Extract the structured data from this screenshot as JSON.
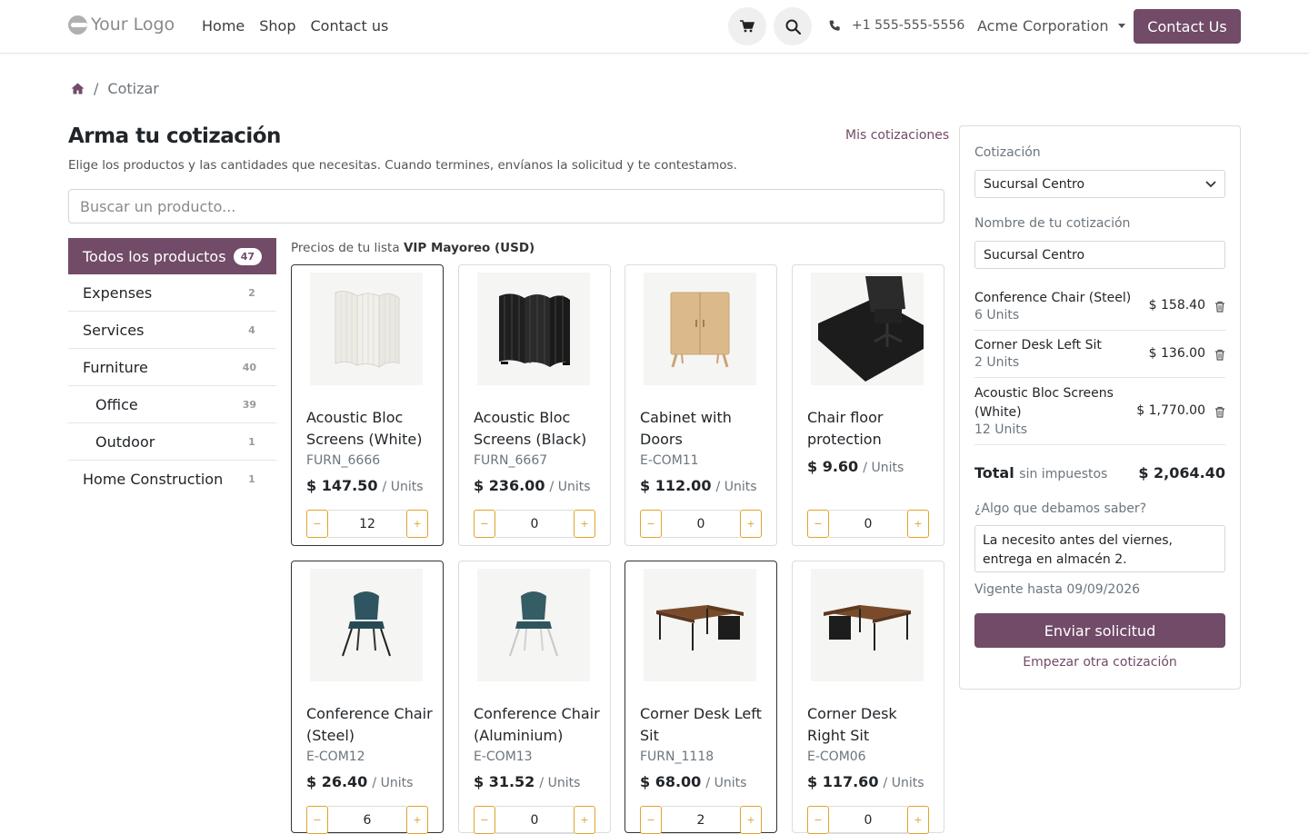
{
  "header": {
    "logo_text": "Your Logo",
    "nav": [
      "Home",
      "Shop",
      "Contact us"
    ],
    "phone": "+1 555-555-5556",
    "company": "Acme Corporation",
    "contact_button": "Contact Us"
  },
  "breadcrumb": {
    "current": "Cotizar"
  },
  "page": {
    "title": "Arma tu cotización",
    "subtitle": "Elige los productos y las cantidades que necesitas. Cuando termines, envíanos la solicitud y te contestamos.",
    "my_quotes_link": "Mis cotizaciones",
    "search_placeholder": "Buscar un producto..."
  },
  "categories": [
    {
      "label": "Todos los productos",
      "count": "47",
      "active": true,
      "sub": false
    },
    {
      "label": "Expenses",
      "count": "2",
      "active": false,
      "sub": false
    },
    {
      "label": "Services",
      "count": "4",
      "active": false,
      "sub": false
    },
    {
      "label": "Furniture",
      "count": "40",
      "active": false,
      "sub": false
    },
    {
      "label": "Office",
      "count": "39",
      "active": false,
      "sub": true
    },
    {
      "label": "Outdoor",
      "count": "1",
      "active": false,
      "sub": true
    },
    {
      "label": "Home Construction",
      "count": "1",
      "active": false,
      "sub": false
    }
  ],
  "pricelist": {
    "prefix": "Precios de tu lista",
    "name": "VIP Mayoreo (USD)"
  },
  "products": [
    {
      "name": "Acoustic Bloc Screens (White)",
      "code": "FURN_6666",
      "price": "$ 147.50",
      "unit": "/ Units",
      "qty": "12",
      "selected": true,
      "img": "screen-white"
    },
    {
      "name": "Acoustic Bloc Screens (Black)",
      "code": "FURN_6667",
      "price": "$ 236.00",
      "unit": "/ Units",
      "qty": "0",
      "selected": false,
      "img": "screen-black"
    },
    {
      "name": "Cabinet with Doors",
      "code": "E-COM11",
      "price": "$ 112.00",
      "unit": "/ Units",
      "qty": "0",
      "selected": false,
      "img": "cabinet"
    },
    {
      "name": "Chair floor protection",
      "code": "",
      "price": "$ 9.60",
      "unit": "/ Units",
      "qty": "0",
      "selected": false,
      "img": "floor-mat"
    },
    {
      "name": "Conference Chair (Steel)",
      "code": "E-COM12",
      "price": "$ 26.40",
      "unit": "/ Units",
      "qty": "6",
      "selected": true,
      "img": "chair-steel"
    },
    {
      "name": "Conference Chair (Aluminium)",
      "code": "E-COM13",
      "price": "$ 31.52",
      "unit": "/ Units",
      "qty": "0",
      "selected": false,
      "img": "chair-alu"
    },
    {
      "name": "Corner Desk Left Sit",
      "code": "FURN_1118",
      "price": "$ 68.00",
      "unit": "/ Units",
      "qty": "2",
      "selected": true,
      "img": "desk-left"
    },
    {
      "name": "Corner Desk Right Sit",
      "code": "E-COM06",
      "price": "$ 117.60",
      "unit": "/ Units",
      "qty": "0",
      "selected": false,
      "img": "desk-right"
    }
  ],
  "quote": {
    "label": "Cotización",
    "selected": "Sucursal Centro",
    "name_label": "Nombre de tu cotización",
    "name_value": "Sucursal Centro",
    "lines": [
      {
        "name": "Conference Chair (Steel)",
        "qty": "6 Units",
        "amount": "$ 158.40"
      },
      {
        "name": "Corner Desk Left Sit",
        "qty": "2 Units",
        "amount": "$ 136.00"
      },
      {
        "name": "Acoustic Bloc Screens (White)",
        "qty": "12 Units",
        "amount": "$ 1,770.00"
      }
    ],
    "total_label": "Total",
    "total_suffix": "sin impuestos",
    "total_value": "$ 2,064.40",
    "notes_label": "¿Algo que debamos saber?",
    "notes_value": "La necesito antes del viernes, entrega en almacén 2.",
    "valid_until": "Vigente hasta 09/09/2026",
    "send_button": "Enviar solicitud",
    "another_link": "Empezar otra cotización"
  },
  "colors": {
    "brand": "#714b67",
    "qty_accent": "#e0a32e"
  }
}
